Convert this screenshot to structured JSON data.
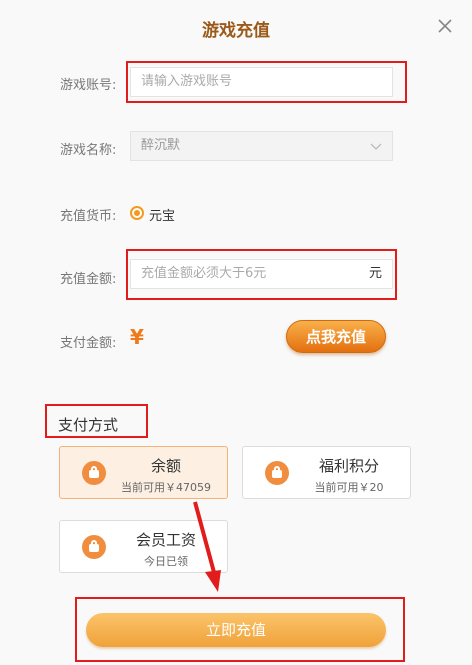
{
  "dialog": {
    "title": "游戏充值"
  },
  "form": {
    "account_label": "游戏账号:",
    "account_placeholder": "请输入游戏账号",
    "game_label": "游戏名称:",
    "game_value": "醉沉默",
    "currency_label": "充值货币:",
    "currency_option": "元宝",
    "amount_label": "充值金额:",
    "amount_placeholder": "充值金额必须大于6元",
    "amount_unit": "元",
    "pay_amount_label": "支付金额:",
    "pay_amount_symbol": "¥",
    "click_button": "点我充值"
  },
  "payment": {
    "title": "支付方式",
    "methods": [
      {
        "name": "余额",
        "sub": "当前可用￥47059"
      },
      {
        "name": "福利积分",
        "sub": "当前可用￥20"
      },
      {
        "name": "会员工资",
        "sub": "今日已领"
      }
    ]
  },
  "submit_label": "立即充值",
  "colors": {
    "accent": "#f39a1e",
    "title": "#9a5a1a",
    "annotation": "#e21b1b"
  },
  "icons": {
    "close": "close-icon",
    "dropdown": "chevron-down-icon",
    "wallet": "wallet-icon"
  }
}
